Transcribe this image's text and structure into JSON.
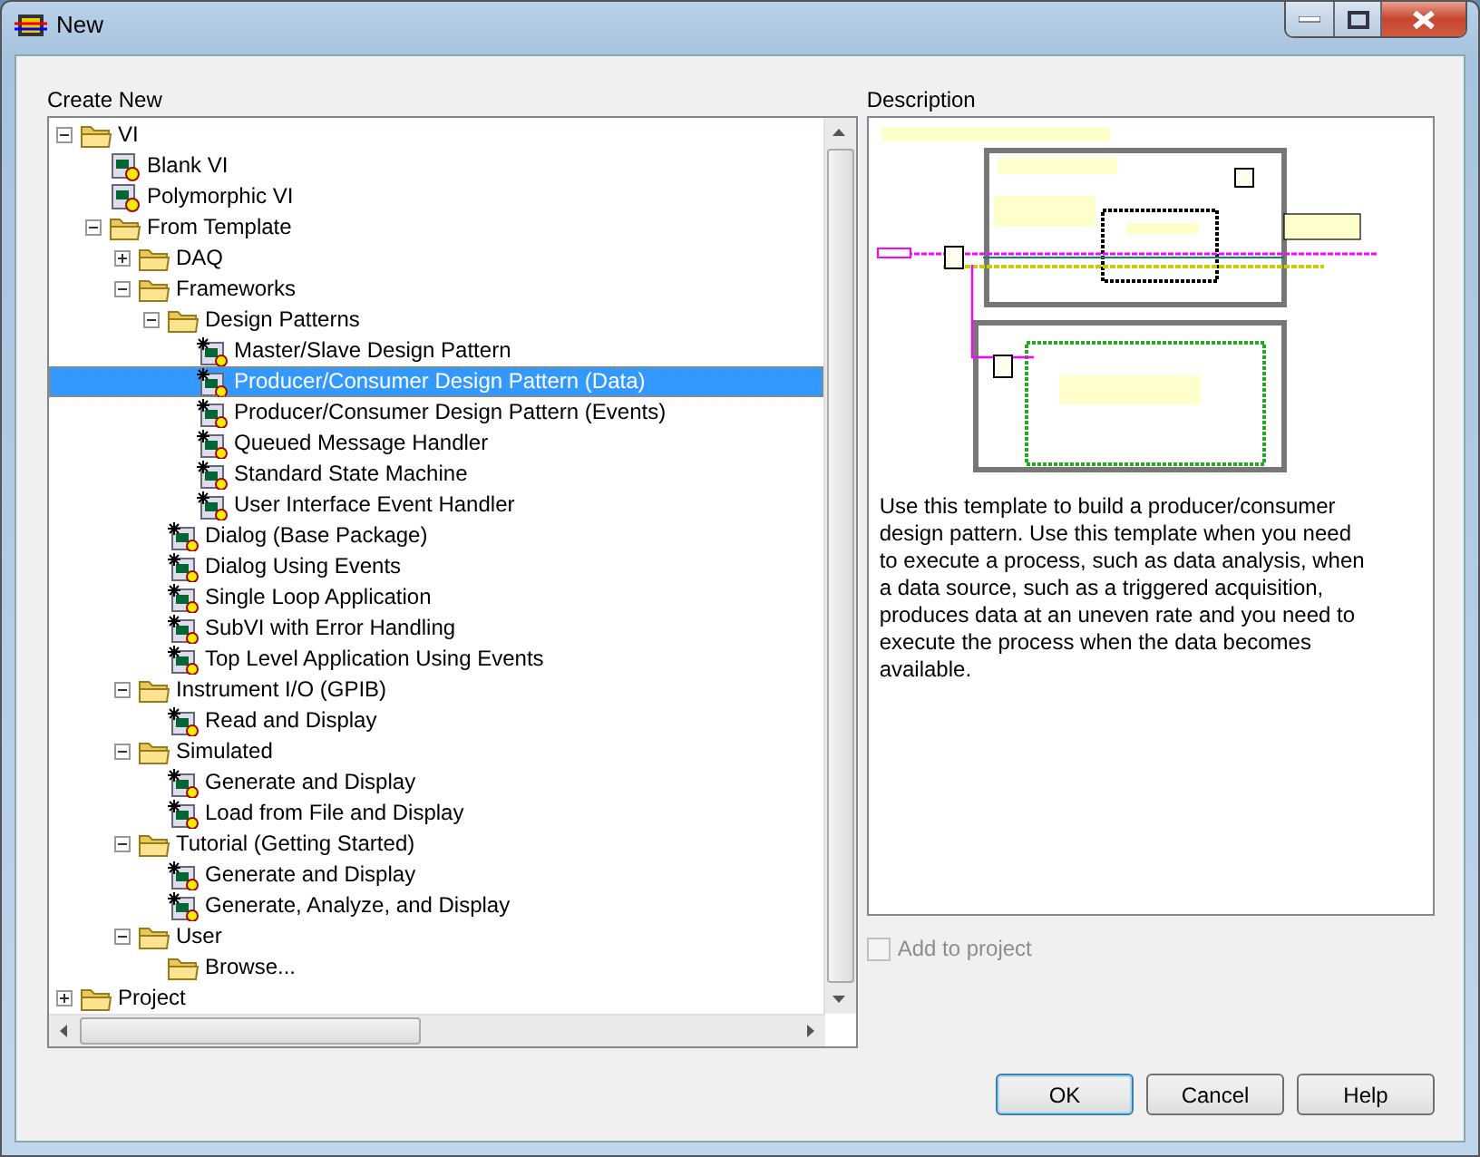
{
  "window": {
    "title": "New"
  },
  "create_new": {
    "label": "Create New",
    "items": [
      {
        "label": "VI",
        "kind": "folder",
        "expanded": true,
        "selected": false,
        "children": [
          {
            "label": "Blank VI",
            "kind": "vi",
            "selected": false
          },
          {
            "label": "Polymorphic VI",
            "kind": "vi",
            "selected": false
          },
          {
            "label": "From Template",
            "kind": "folder",
            "expanded": true,
            "selected": false,
            "children": [
              {
                "label": "DAQ",
                "kind": "folder",
                "expanded": false,
                "selected": false
              },
              {
                "label": "Frameworks",
                "kind": "folder",
                "expanded": true,
                "selected": false,
                "children": [
                  {
                    "label": "Design Patterns",
                    "kind": "folder",
                    "expanded": true,
                    "selected": false,
                    "children": [
                      {
                        "label": "Master/Slave Design Pattern",
                        "kind": "template",
                        "selected": false
                      },
                      {
                        "label": "Producer/Consumer Design Pattern (Data)",
                        "kind": "template",
                        "selected": true
                      },
                      {
                        "label": "Producer/Consumer Design Pattern (Events)",
                        "kind": "template",
                        "selected": false
                      },
                      {
                        "label": "Queued Message Handler",
                        "kind": "template",
                        "selected": false
                      },
                      {
                        "label": "Standard State Machine",
                        "kind": "template",
                        "selected": false
                      },
                      {
                        "label": "User Interface Event Handler",
                        "kind": "template",
                        "selected": false
                      }
                    ]
                  },
                  {
                    "label": "Dialog (Base Package)",
                    "kind": "template",
                    "selected": false
                  },
                  {
                    "label": "Dialog Using Events",
                    "kind": "template",
                    "selected": false
                  },
                  {
                    "label": "Single Loop Application",
                    "kind": "template",
                    "selected": false
                  },
                  {
                    "label": "SubVI with Error Handling",
                    "kind": "template",
                    "selected": false
                  },
                  {
                    "label": "Top Level Application Using Events",
                    "kind": "template",
                    "selected": false
                  }
                ]
              },
              {
                "label": "Instrument I/O (GPIB)",
                "kind": "folder",
                "expanded": true,
                "selected": false,
                "children": [
                  {
                    "label": "Read and Display",
                    "kind": "template",
                    "selected": false
                  }
                ]
              },
              {
                "label": "Simulated",
                "kind": "folder",
                "expanded": true,
                "selected": false,
                "children": [
                  {
                    "label": "Generate and Display",
                    "kind": "template",
                    "selected": false
                  },
                  {
                    "label": "Load from File and Display",
                    "kind": "template",
                    "selected": false
                  }
                ]
              },
              {
                "label": "Tutorial (Getting Started)",
                "kind": "folder",
                "expanded": true,
                "selected": false,
                "children": [
                  {
                    "label": "Generate and Display",
                    "kind": "template",
                    "selected": false
                  },
                  {
                    "label": "Generate, Analyze, and Display",
                    "kind": "template",
                    "selected": false
                  }
                ]
              },
              {
                "label": "User",
                "kind": "folder",
                "expanded": true,
                "selected": false,
                "children": [
                  {
                    "label": "Browse...",
                    "kind": "folder",
                    "selected": false
                  }
                ]
              }
            ]
          }
        ]
      },
      {
        "label": "Project",
        "kind": "folder",
        "expanded": false,
        "selected": false
      }
    ]
  },
  "description": {
    "label": "Description",
    "text": "Use this template to build a producer/consumer design pattern. Use this template when you need to execute a process, such as data analysis, when a data source, such as a triggered acquisition, produces data at an uneven rate and you need to execute the process when the data becomes available."
  },
  "add_to_project": {
    "label": "Add to project",
    "checked": false,
    "disabled": true
  },
  "buttons": [
    {
      "label": "OK",
      "default": true
    },
    {
      "label": "Cancel",
      "default": false
    },
    {
      "label": "Help",
      "default": false
    }
  ]
}
